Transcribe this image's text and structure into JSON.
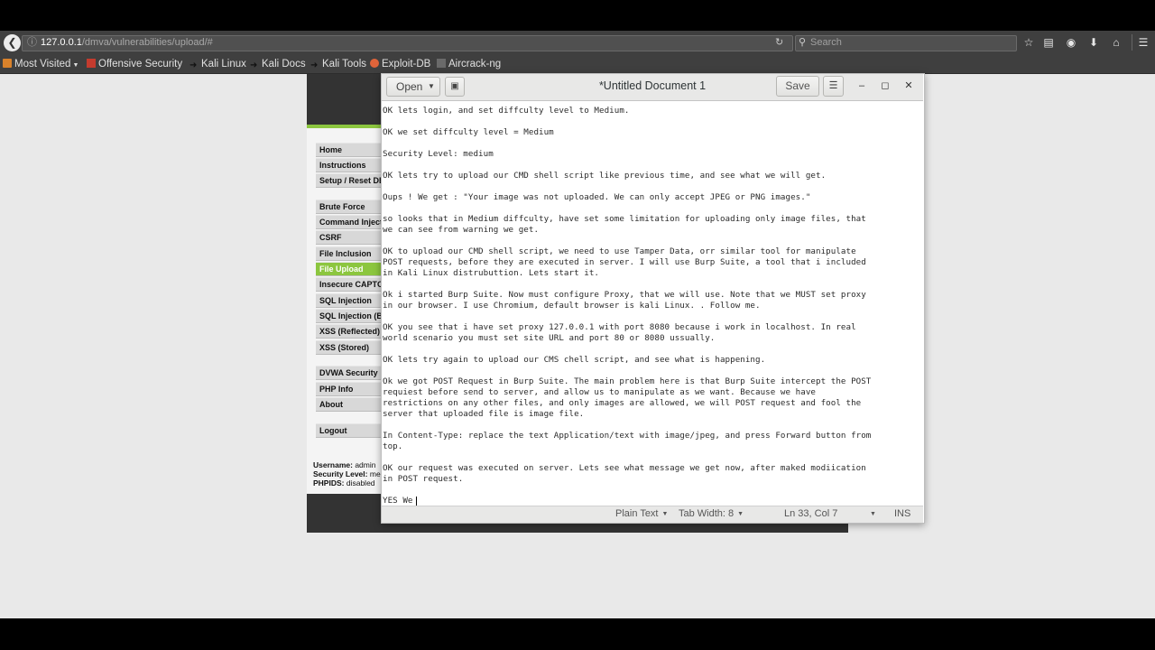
{
  "browser": {
    "url_host": "127.0.0.1",
    "url_path": "/dmva/vulnerabilities/upload/#",
    "search_placeholder": "Search",
    "bookmarks": [
      {
        "label": "Most Visited",
        "icon": "folder-icon",
        "color": "#d9822b"
      },
      {
        "label": "Offensive Security",
        "icon": "offsec-icon",
        "color": "#c43b2e"
      },
      {
        "label": "Kali Linux",
        "icon": "kali-icon",
        "color": "#1e1e1e"
      },
      {
        "label": "Kali Docs",
        "icon": "kali-icon",
        "color": "#1e1e1e"
      },
      {
        "label": "Kali Tools",
        "icon": "kali-icon",
        "color": "#1e1e1e"
      },
      {
        "label": "Exploit-DB",
        "icon": "exploit-db-icon",
        "color": "#e0643a"
      },
      {
        "label": "Aircrack-ng",
        "icon": "aircrack-icon",
        "color": "#6a6a6a"
      }
    ],
    "toolbar_icons": [
      "star-icon",
      "reading-list-icon",
      "pocket-icon",
      "download-icon",
      "home-icon",
      "menu-icon"
    ]
  },
  "dvwa": {
    "menu": [
      {
        "label": "Home"
      },
      {
        "label": "Instructions"
      },
      {
        "label": "Setup / Reset DB"
      },
      {
        "label": "Brute Force"
      },
      {
        "label": "Command Injection"
      },
      {
        "label": "CSRF"
      },
      {
        "label": "File Inclusion"
      },
      {
        "label": "File Upload",
        "selected": true
      },
      {
        "label": "Insecure CAPTCHA"
      },
      {
        "label": "SQL Injection"
      },
      {
        "label": "SQL Injection (Blind)"
      },
      {
        "label": "XSS (Reflected)"
      },
      {
        "label": "XSS (Stored)"
      },
      {
        "label": "DVWA Security"
      },
      {
        "label": "PHP Info"
      },
      {
        "label": "About"
      },
      {
        "label": "Logout"
      }
    ],
    "info": {
      "username_label": "Username:",
      "username": "admin",
      "security_label": "Security Level:",
      "security": "medium",
      "phpids_label": "PHPIDS:",
      "phpids": "disabled"
    },
    "accent": "#8cc63f"
  },
  "editor": {
    "open_label": "Open",
    "save_label": "Save",
    "title": "*Untitled Document 1",
    "lines": [
      "OK lets login, and set diffculty level to Medium.",
      "",
      "OK we set diffculty level = Medium",
      "",
      "Security Level: medium",
      "",
      "OK lets try to upload our CMD shell script like previous time, and see what we will get.",
      "",
      "Oups ! We get : \"Your image was not uploaded. We can only accept JPEG or PNG images.\"",
      "",
      "so looks that in Medium diffculty, have set some limitation for uploading only image files, that",
      "we can see from warning we get.",
      "",
      "OK to upload our CMD shell script, we need to use Tamper Data, orr similar tool for manipulate",
      "POST requests, before they are executed in server. I will use Burp Suite, a tool that i included",
      "in Kali Linux distrubuttion. Lets start it.",
      "",
      "Ok i started Burp Suite. Now must configure Proxy, that we will use. Note that we MUST set proxy",
      "in our browser. I use Chromium, default browser is kali Linux. . Follow me.",
      "",
      "OK you see that i have set proxy 127.0.0.1 with port 8080 because i work in localhost. In real",
      "world scenario you must set site URL and port 80 or 8080 ussually.",
      "",
      "OK lets try again to upload our CMS chell script, and see what is happening.",
      "",
      "Ok we got POST Request in Burp Suite. The main problem here is that Burp Suite intercept the POST",
      "requiest before send to server, and allow us to manipulate as we want. Because we have",
      "restrictions on any other files, and only images are allowed, we will POST request and fool the",
      "server that uploaded file is image file.",
      "",
      "In Content-Type: replace the text Application/text with image/jpeg, and press Forward button from",
      "top.",
      "",
      "OK our request was executed on server. Lets see what message we get now, after maked modiication",
      "in POST request.",
      "",
      "YES We"
    ],
    "status": {
      "syntax": "Plain Text",
      "tab_width": "Tab Width: 8",
      "position": "Ln 33, Col 7",
      "mode": "INS"
    }
  }
}
